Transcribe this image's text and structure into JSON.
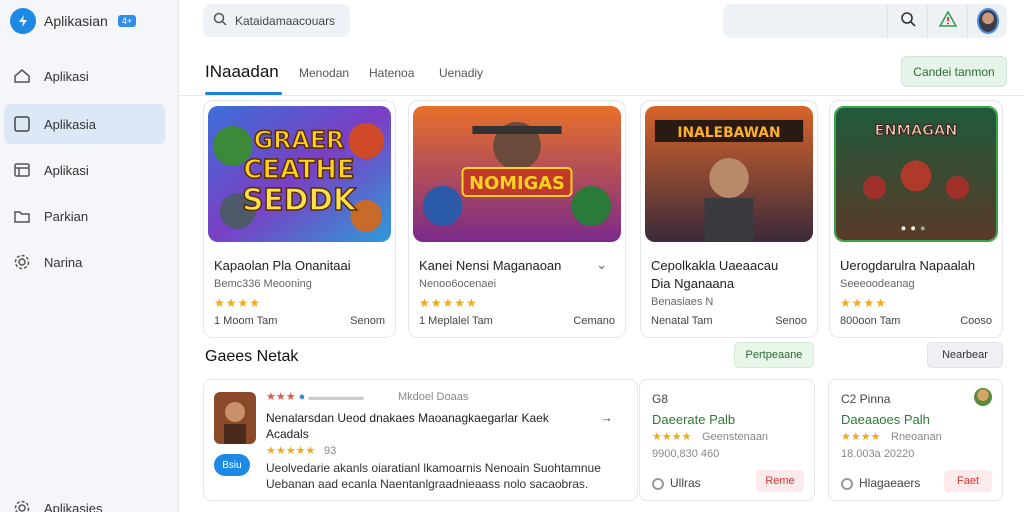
{
  "brand": {
    "name": "Aplikasian",
    "badge": "4+"
  },
  "sidebar": {
    "items": [
      {
        "label": "Aplikasi",
        "icon": "home-icon"
      },
      {
        "label": "Aplikasia",
        "icon": "square-icon"
      },
      {
        "label": "Aplikasi",
        "icon": "window-icon"
      },
      {
        "label": "Parkian",
        "icon": "folder-icon"
      },
      {
        "label": "Narina",
        "icon": "gear-icon"
      },
      {
        "label": "Aplikasies",
        "icon": "gear-icon"
      }
    ]
  },
  "search": {
    "placeholder": "Kataidamaacouars"
  },
  "tabs": [
    {
      "label": "INaaadan"
    },
    {
      "label": "Menodan"
    },
    {
      "label": "Hatenoa"
    },
    {
      "label": "Uenadiy"
    }
  ],
  "cta_label": "Candei tanmon",
  "games": [
    {
      "art_text": [
        "GRAER",
        "CEATHE",
        "SEDDK"
      ],
      "title": "Kapaolan Pla Onanitaai",
      "sub": "Bemc336 Meooning",
      "stars": "★★★★",
      "foot_left": "1 Moom Tam",
      "foot_right": "Senom"
    },
    {
      "art_text": [
        "NOMIGAS"
      ],
      "title": "Kanei Nensi Maganaoan",
      "sub": "Nenoo6ocenaei",
      "stars": "★★★★★",
      "foot_left": "1 Meplalel Tam",
      "foot_right": "Cemano"
    },
    {
      "art_text": [
        "INALEBAWAN"
      ],
      "title": "Cepolkakla Uaeaacau Dia Nganaana",
      "sub": "Benasiaes N",
      "stars": "",
      "foot_left": "Nenatal Tam",
      "foot_right": "Senoo"
    },
    {
      "art_text": [
        "ENMAGAN"
      ],
      "title": "Uerogdarulra Napaalah",
      "sub": "Seeeoodeanag",
      "stars": "★★★★",
      "foot_left": "800oon Tam",
      "foot_right": "Cooso"
    }
  ],
  "section": {
    "title": "Gaees Netak",
    "pill_green": "Pertpeaane",
    "pill_gray": "Nearbear"
  },
  "review": {
    "header": "Mkdoel Doaas",
    "title": "Nenalarsdan Ueod dnakaes Maoanagkaegarlar Kaek Acadals",
    "stars": "★★★★★",
    "count": "93",
    "chip": "Bsiu",
    "body": "Ueolvedarie akanls oiaratianl lkamoarnis Nenoain Suohtamnue Uebanan aad ecanla Naentanlgraadnieaass nolo sacaobras."
  },
  "mini1": {
    "top": "G8",
    "title": "Daeerate Palb",
    "stars": "★★★★",
    "sub": "Geenstenaan",
    "meta": "9900,830 460",
    "pin_label": "Ullras",
    "btn": "Reme"
  },
  "mini2": {
    "top": "C2 Pinna",
    "title": "Daeaaoes Palh",
    "stars": "★★★★",
    "sub": "Rneoanan",
    "meta": "18.003a 20220",
    "pin_label": "Hlagaeaers",
    "btn": "Faet"
  }
}
